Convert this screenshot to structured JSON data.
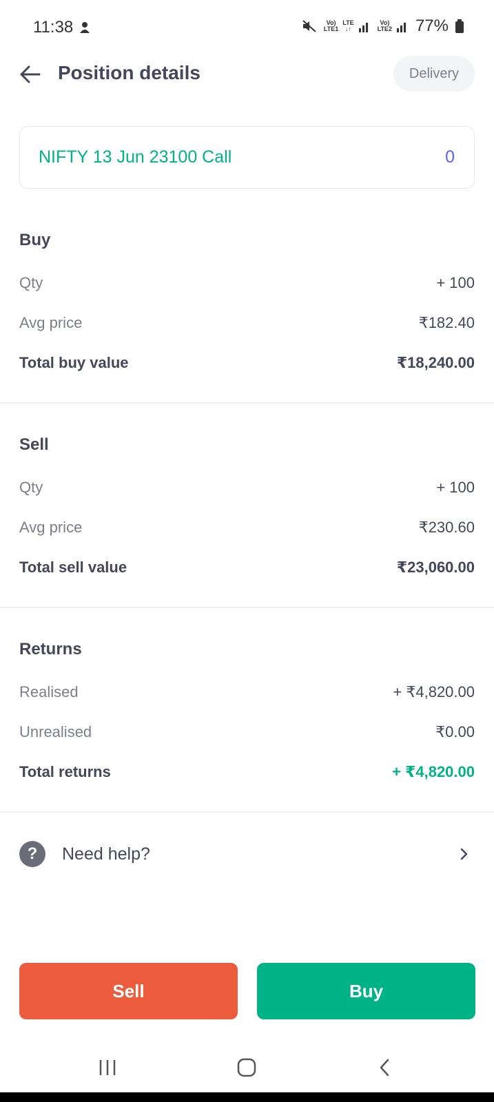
{
  "status_bar": {
    "time": "11:38",
    "sim1_label_top": "Vo)",
    "sim1_label_bottom": "LTE1",
    "data_label_top": "LTE",
    "data_label_bottom": "↓↑",
    "sim2_label_top": "Vo)",
    "sim2_label_bottom": "LTE2",
    "battery": "77%",
    "icons": [
      "mute-icon",
      "signal-icon",
      "battery-icon"
    ]
  },
  "header": {
    "title": "Position details",
    "badge": "Delivery",
    "back_icon": "back-arrow-icon"
  },
  "instrument": {
    "name": "NIFTY 13 Jun 23100 Call",
    "quantity": "0"
  },
  "buy_section": {
    "title": "Buy",
    "rows": [
      {
        "label": "Qty",
        "value": "+ 100"
      },
      {
        "label": "Avg price",
        "value": "₹182.40"
      },
      {
        "label": "Total buy value",
        "value": "₹18,240.00"
      }
    ]
  },
  "sell_section": {
    "title": "Sell",
    "rows": [
      {
        "label": "Qty",
        "value": "+ 100"
      },
      {
        "label": "Avg price",
        "value": "₹230.60"
      },
      {
        "label": "Total sell value",
        "value": "₹23,060.00"
      }
    ]
  },
  "returns_section": {
    "title": "Returns",
    "rows": [
      {
        "label": "Realised",
        "value": "+ ₹4,820.00"
      },
      {
        "label": "Unrealised",
        "value": "₹0.00"
      },
      {
        "label": "Total returns",
        "value": "+ ₹4,820.00"
      }
    ]
  },
  "help": {
    "label": "Need help?",
    "icon_glyph": "?"
  },
  "actions": {
    "sell_label": "Sell",
    "buy_label": "Buy"
  },
  "colors": {
    "green": "#00b386",
    "red": "#eb5b3c",
    "blue": "#5367ff",
    "text": "#44475b",
    "muted": "#7c7e8c"
  }
}
